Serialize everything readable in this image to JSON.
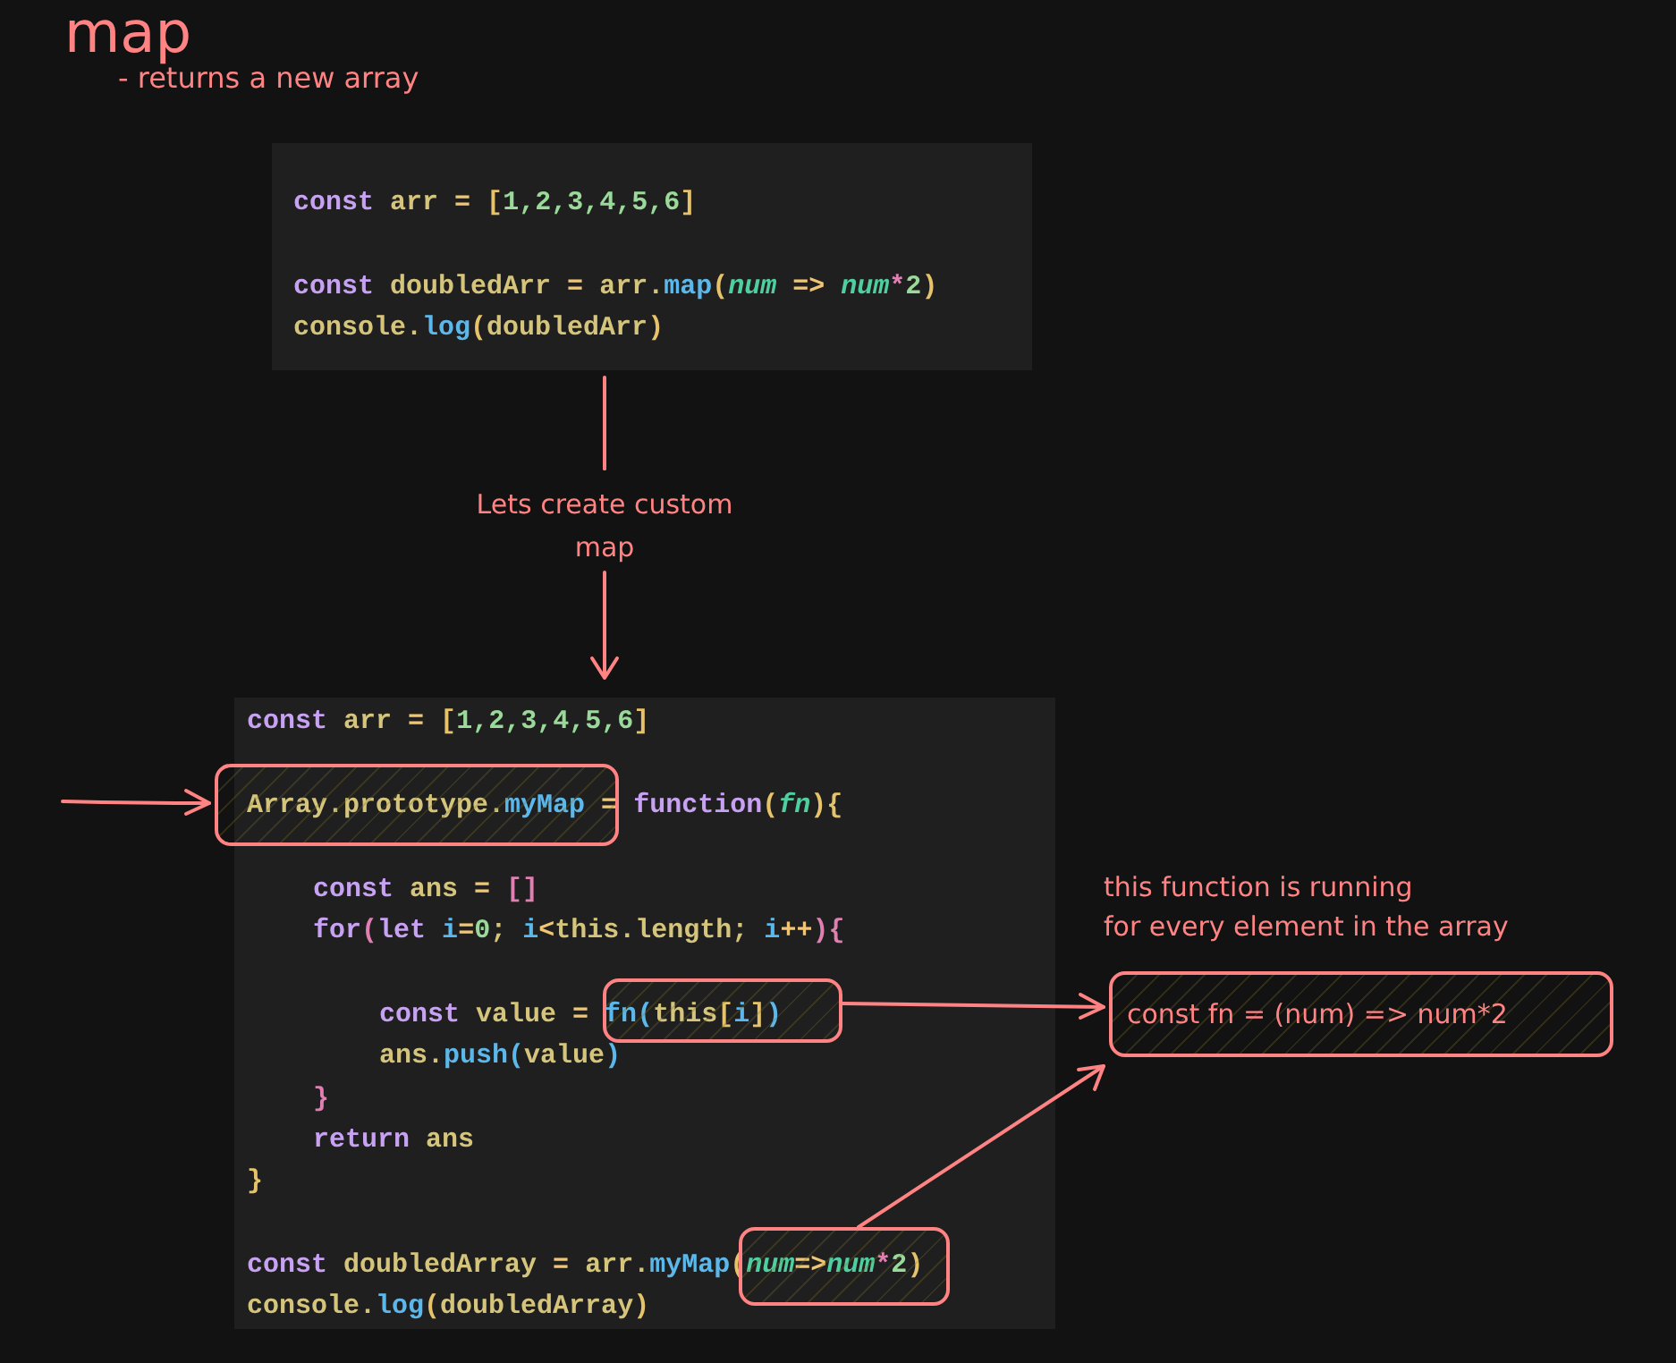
{
  "title": "map",
  "subtitle": "- returns a new array",
  "snippets": [
    {
      "lines": [
        {
          "kind": "code",
          "tokens": [
            {
              "kind": "kw",
              "text": "const "
            },
            {
              "kind": "id",
              "text": "arr "
            },
            {
              "kind": "op",
              "text": "= "
            },
            {
              "kind": "punc",
              "text": "["
            },
            {
              "kind": "num",
              "text": "1,2,3,4,5,6"
            },
            {
              "kind": "punc",
              "text": "]"
            }
          ]
        },
        {
          "kind": "blank"
        },
        {
          "kind": "code",
          "tokens": [
            {
              "kind": "kw",
              "text": "const "
            },
            {
              "kind": "id",
              "text": "doubledArr "
            },
            {
              "kind": "op",
              "text": "= "
            },
            {
              "kind": "id",
              "text": "arr."
            },
            {
              "kind": "fn",
              "text": "map"
            },
            {
              "kind": "punc",
              "text": "("
            },
            {
              "kind": "param",
              "text": "num"
            },
            {
              "kind": "op",
              "text": " => "
            },
            {
              "kind": "param",
              "text": "num"
            },
            {
              "kind": "brace",
              "text": "*"
            },
            {
              "kind": "num",
              "text": "2"
            },
            {
              "kind": "punc",
              "text": ")"
            }
          ]
        },
        {
          "kind": "code",
          "tokens": [
            {
              "kind": "id",
              "text": "console."
            },
            {
              "kind": "fn",
              "text": "log"
            },
            {
              "kind": "punc",
              "text": "("
            },
            {
              "kind": "id",
              "text": "doubledArr"
            },
            {
              "kind": "punc",
              "text": ")"
            }
          ]
        }
      ]
    },
    {
      "lines": [
        {
          "kind": "code",
          "tokens": [
            {
              "kind": "kw",
              "text": "const "
            },
            {
              "kind": "id",
              "text": "arr "
            },
            {
              "kind": "op",
              "text": "= "
            },
            {
              "kind": "punc",
              "text": "["
            },
            {
              "kind": "num",
              "text": "1,2,3,4,5,6"
            },
            {
              "kind": "punc",
              "text": "]"
            }
          ]
        },
        {
          "kind": "blank"
        },
        {
          "kind": "code",
          "tokens": [
            {
              "kind": "id",
              "text": "Array.prototype."
            },
            {
              "kind": "fn",
              "text": "myMap "
            },
            {
              "kind": "op",
              "text": "= "
            },
            {
              "kind": "kw",
              "text": "function"
            },
            {
              "kind": "punc",
              "text": "("
            },
            {
              "kind": "param",
              "text": "fn"
            },
            {
              "kind": "punc",
              "text": "){"
            }
          ],
          "children": [
            {
              "kind": "blank"
            },
            {
              "kind": "code",
              "tokens": [
                {
                  "kind": "kw",
                  "text": "const "
                },
                {
                  "kind": "id",
                  "text": "ans "
                },
                {
                  "kind": "op",
                  "text": "= "
                },
                {
                  "kind": "brace",
                  "text": "[]"
                }
              ]
            },
            {
              "kind": "code",
              "tokens": [
                {
                  "kind": "kw",
                  "text": "for"
                },
                {
                  "kind": "brace",
                  "text": "("
                },
                {
                  "kind": "kw",
                  "text": "let "
                },
                {
                  "kind": "fn",
                  "text": "i"
                },
                {
                  "kind": "op",
                  "text": "="
                },
                {
                  "kind": "num",
                  "text": "0"
                },
                {
                  "kind": "id",
                  "text": "; "
                },
                {
                  "kind": "fn",
                  "text": "i"
                },
                {
                  "kind": "op",
                  "text": "<"
                },
                {
                  "kind": "id",
                  "text": "this.length; "
                },
                {
                  "kind": "fn",
                  "text": "i"
                },
                {
                  "kind": "op",
                  "text": "++"
                },
                {
                  "kind": "brace",
                  "text": "){"
                }
              ],
              "children": [
                {
                  "kind": "blank"
                },
                {
                  "kind": "code",
                  "tokens": [
                    {
                      "kind": "kw",
                      "text": "const "
                    },
                    {
                      "kind": "id",
                      "text": "value "
                    },
                    {
                      "kind": "op",
                      "text": "= "
                    },
                    {
                      "kind": "fn",
                      "text": "fn"
                    },
                    {
                      "kind": "fn",
                      "text": "("
                    },
                    {
                      "kind": "id",
                      "text": "this"
                    },
                    {
                      "kind": "punc",
                      "text": "["
                    },
                    {
                      "kind": "fn",
                      "text": "i"
                    },
                    {
                      "kind": "punc",
                      "text": "]"
                    },
                    {
                      "kind": "fn",
                      "text": ")"
                    }
                  ]
                },
                {
                  "kind": "code",
                  "tokens": [
                    {
                      "kind": "id",
                      "text": "ans."
                    },
                    {
                      "kind": "fn",
                      "text": "push"
                    },
                    {
                      "kind": "fn",
                      "text": "("
                    },
                    {
                      "kind": "id",
                      "text": "value"
                    },
                    {
                      "kind": "fn",
                      "text": ")"
                    }
                  ]
                }
              ]
            },
            {
              "kind": "code",
              "tokens": [
                {
                  "kind": "brace",
                  "text": "}"
                }
              ]
            },
            {
              "kind": "code",
              "tokens": [
                {
                  "kind": "kw",
                  "text": "return "
                },
                {
                  "kind": "id",
                  "text": "ans"
                }
              ]
            }
          ]
        },
        {
          "kind": "code",
          "tokens": [
            {
              "kind": "punc",
              "text": "}"
            }
          ]
        },
        {
          "kind": "blank"
        },
        {
          "kind": "code",
          "tokens": [
            {
              "kind": "kw",
              "text": "const "
            },
            {
              "kind": "id",
              "text": "doubledArray "
            },
            {
              "kind": "op",
              "text": "= "
            },
            {
              "kind": "id",
              "text": "arr."
            },
            {
              "kind": "fn",
              "text": "myMap"
            },
            {
              "kind": "punc",
              "text": "("
            },
            {
              "kind": "param",
              "text": "num"
            },
            {
              "kind": "op",
              "text": "=>"
            },
            {
              "kind": "param",
              "text": "num"
            },
            {
              "kind": "brace",
              "text": "*"
            },
            {
              "kind": "num",
              "text": "2"
            },
            {
              "kind": "punc",
              "text": ")"
            }
          ]
        },
        {
          "kind": "code",
          "tokens": [
            {
              "kind": "id",
              "text": "console."
            },
            {
              "kind": "fn",
              "text": "log"
            },
            {
              "kind": "punc",
              "text": "("
            },
            {
              "kind": "id",
              "text": "doubledArray"
            },
            {
              "kind": "punc",
              "text": ")"
            }
          ]
        }
      ]
    }
  ],
  "connector_label": [
    "Lets create custom",
    "map"
  ],
  "note": [
    "this function is running",
    "for every element in the array"
  ],
  "callout": "const fn = (num) => num*2"
}
